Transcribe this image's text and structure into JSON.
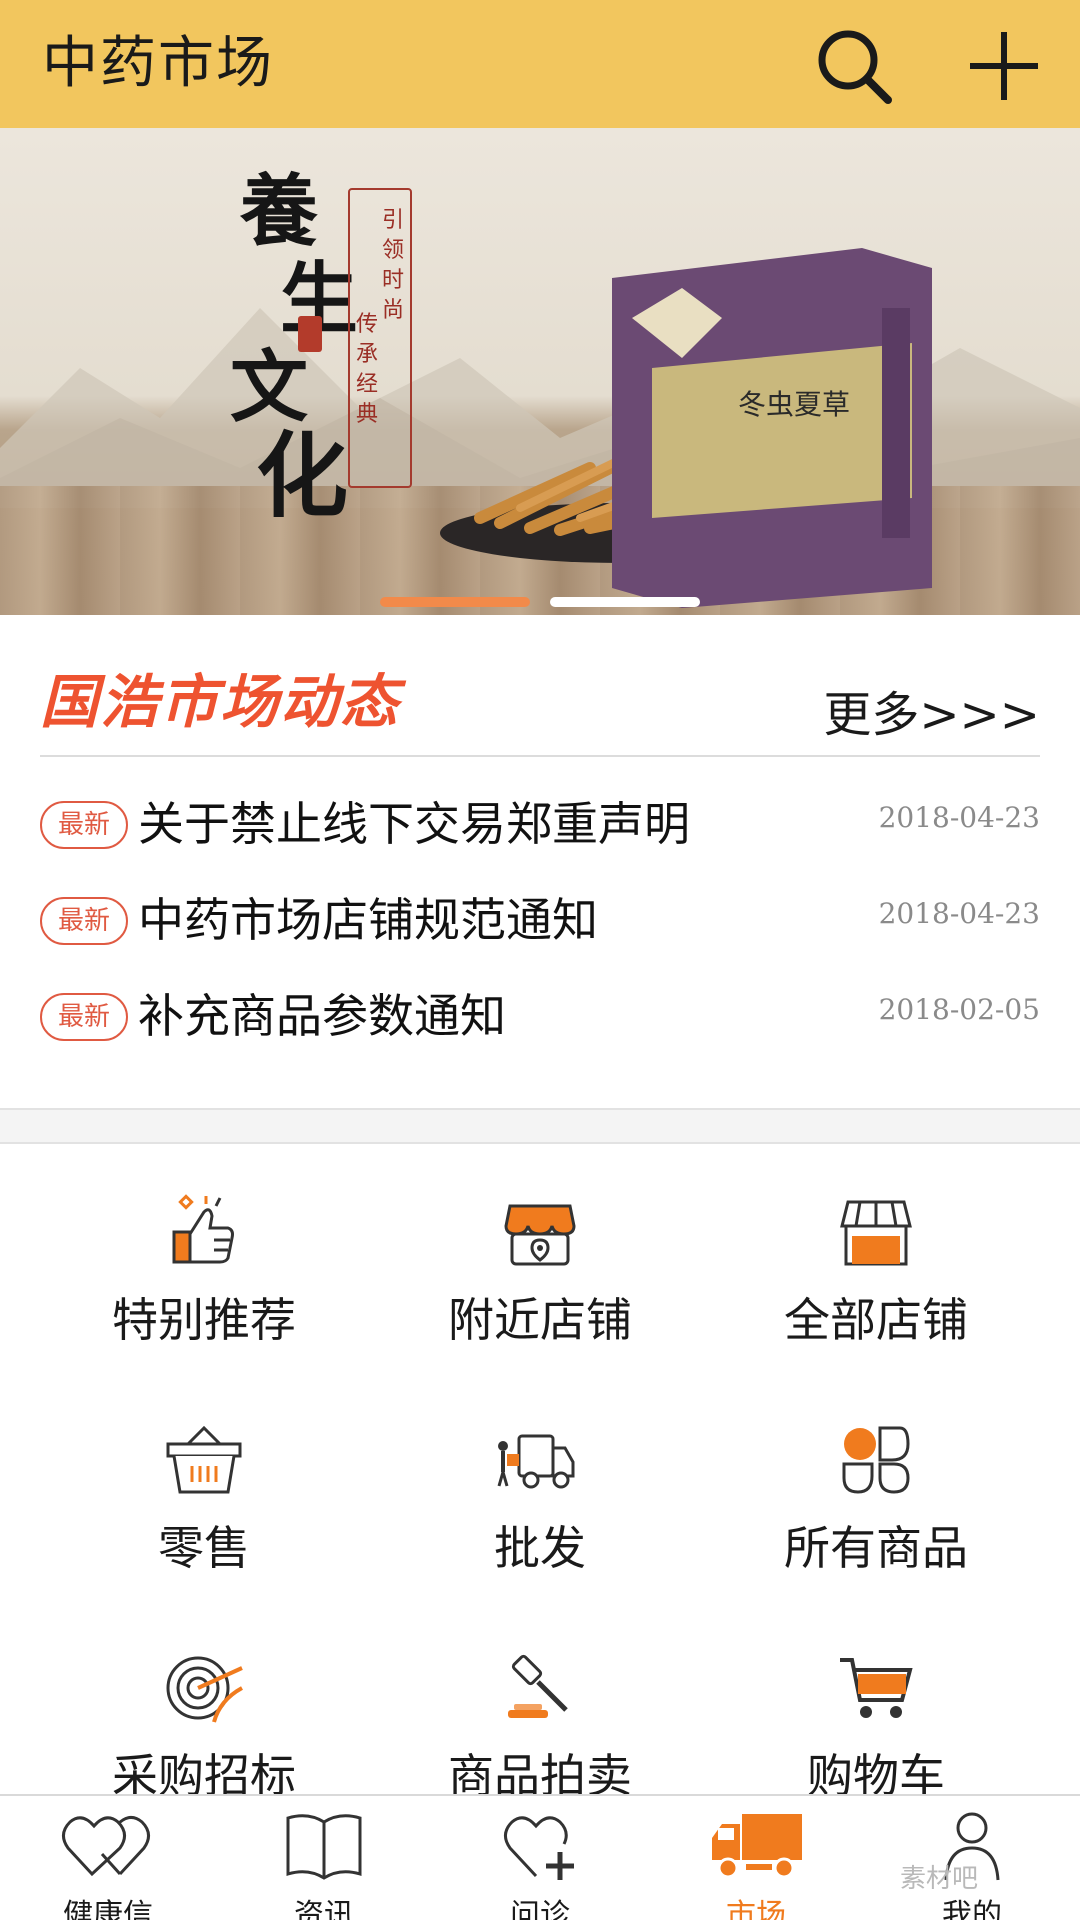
{
  "header": {
    "title": "中药市场"
  },
  "banner": {
    "calligraphy": [
      "養",
      "生",
      "文",
      "化"
    ],
    "slogan_col1": "引领时尚",
    "slogan_col2": "传承经典",
    "product_name": "冬虫夏草",
    "carousel": {
      "current_index": 0,
      "count": 2
    }
  },
  "news": {
    "title": "国浩市场动态",
    "more_label": "更多>>>",
    "items": [
      {
        "badge": "最新",
        "text": "关于禁止线下交易郑重声明",
        "date": "2018-04-23"
      },
      {
        "badge": "最新",
        "text": "中药市场店铺规范通知",
        "date": "2018-04-23"
      },
      {
        "badge": "最新",
        "text": "补充商品参数通知",
        "date": "2018-02-05"
      }
    ]
  },
  "grid": {
    "items": [
      {
        "label": "特别推荐",
        "icon": "thumbs-up-icon"
      },
      {
        "label": "附近店铺",
        "icon": "nearby-store-icon"
      },
      {
        "label": "全部店铺",
        "icon": "store-icon"
      },
      {
        "label": "零售",
        "icon": "basket-icon"
      },
      {
        "label": "批发",
        "icon": "delivery-truck-icon"
      },
      {
        "label": "所有商品",
        "icon": "clover-grid-icon"
      },
      {
        "label": "采购招标",
        "icon": "target-icon"
      },
      {
        "label": "商品拍卖",
        "icon": "auction-gavel-icon"
      },
      {
        "label": "购物车",
        "icon": "shopping-cart-icon"
      }
    ]
  },
  "tabbar": {
    "items": [
      {
        "label": "健康信",
        "icon": "double-heart-icon",
        "active": false
      },
      {
        "label": "资讯",
        "icon": "book-icon",
        "active": false
      },
      {
        "label": "问诊",
        "icon": "heart-plus-icon",
        "active": false
      },
      {
        "label": "市场",
        "icon": "truck-icon",
        "active": true
      },
      {
        "label": "我的",
        "icon": "user-icon",
        "active": false
      }
    ]
  },
  "colors": {
    "header_bg": "#f2c65e",
    "accent_orange": "#f07b1e",
    "news_title_red": "#ee5330",
    "badge_red": "#e05a42"
  },
  "watermark": "素材吧"
}
